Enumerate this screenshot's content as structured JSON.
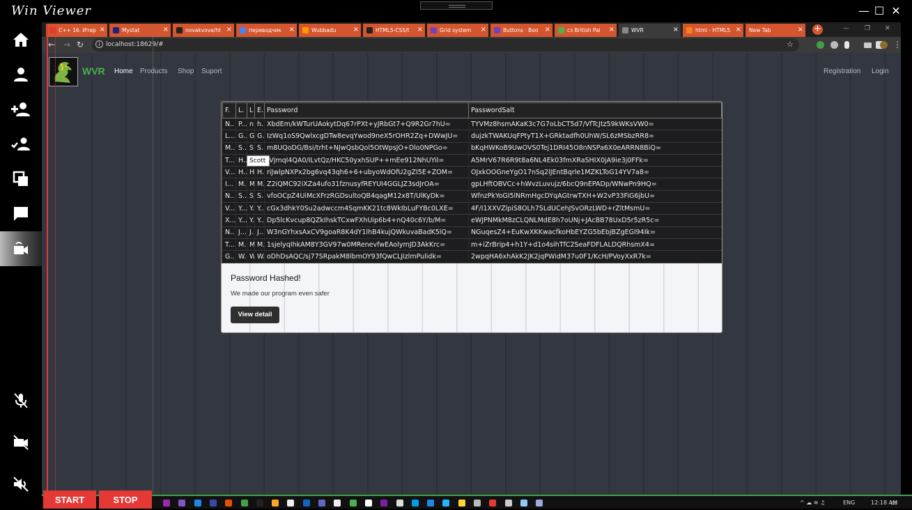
{
  "app": {
    "title": "Win Viewer",
    "window_controls": [
      "—",
      "☐",
      "✕"
    ]
  },
  "sidebar": {
    "items": [
      {
        "icon": "home-icon"
      },
      {
        "icon": "user-icon"
      },
      {
        "icon": "add-user-icon"
      },
      {
        "icon": "group-icon"
      },
      {
        "icon": "copy-icon"
      },
      {
        "icon": "chat-icon"
      },
      {
        "icon": "video-call-icon",
        "active": true
      },
      {
        "icon": "mic-off-icon"
      },
      {
        "icon": "camera-off-icon"
      },
      {
        "icon": "volume-off-icon"
      }
    ]
  },
  "browser": {
    "tabs": [
      {
        "label": "C++ 16. Итер",
        "color": "#e53935"
      },
      {
        "label": "Mystat",
        "color": "#1a237e"
      },
      {
        "label": "novakvova/ht",
        "color": "#222222"
      },
      {
        "label": "переводчик",
        "color": "#4285f4"
      },
      {
        "label": "Wubbadu",
        "color": "#ff9800"
      },
      {
        "label": "HTML5-CSS/t",
        "color": "#222222"
      },
      {
        "label": "Grid system",
        "color": "#6f42c1"
      },
      {
        "label": "Buttons · Boo",
        "color": "#6f42c1"
      },
      {
        "label": "сз British Pai",
        "color": "#4caf50"
      },
      {
        "label": "WVR",
        "color": "#888888",
        "active": true
      },
      {
        "label": "html - HTML5",
        "color": "#f48024"
      },
      {
        "label": "New Tab",
        "color": ""
      }
    ],
    "newtab_symbol": "+",
    "url": "localhost:18629/#",
    "nav_symbols": {
      "back": "←",
      "forward": "→",
      "reload": "↻",
      "info": "i",
      "star": "☆",
      "menu": "⋮"
    }
  },
  "site": {
    "brand": "WVR",
    "nav": [
      "Home",
      "Products",
      "Shop",
      "Suport"
    ],
    "nav_right": [
      "Registration",
      "Login"
    ]
  },
  "table": {
    "headers": [
      "F.",
      "L.",
      "L",
      "E.",
      "Password",
      "PasswordSalt"
    ],
    "rows": [
      [
        "N..",
        "P...",
        "n..",
        "h...",
        "XbdEm/kWTurUAokytDq67rPXt+yJRbGt7+Q9R2Gr7hU=",
        "TYVMz8hsmAKaK3c7G7oLbCT5d7/VfTcJtz59kWKsVW0="
      ],
      [
        "L...",
        "G..",
        "G.",
        "G..",
        "IzWq1oS9QwlxcgDTw8evqYwod9neX5rOHR2Zq+DWwJU=",
        "dujzkTWAKUqFPtyT1X+GRktadfh0UhW/SL6zMSbzRR8="
      ],
      [
        "M..",
        "S...",
        "S..",
        "S...",
        "m8UQoDG/Bsi/trht+NJwQsbQol5OtWpsJO+Dlo0NPGo=",
        "bKqHWKoB9UwOVS0Tej1DRI45O8nNSPa6X0eARRN8BiQ="
      ],
      [
        "T...",
        "H...",
        "",
        "",
        "/VjmqI4QA0/ILvtQz/HKC50yxhSUP++mEe912NhUYiI=",
        "A5MrV67R6R9t8a6NL4Ek03fmXRaSHIX0jA9ie3j0FFk="
      ],
      [
        "V...",
        "H..",
        "H",
        "H..",
        "riJwlpNXPx2bg6vq43qh6+6+ubyoWdOfU2gZI5E+ZOM=",
        "OJxkOOGneYgO17nSq2lJEntBqrle1MZKLToG14YV7a8="
      ],
      [
        "I...",
        "M..",
        "M",
        "M..",
        "Z2iQMC92iXZa4ufo31fznusyfREYUI4GGLJZ3sdJrOA=",
        "gpLHftOBVCc+hWvzLuvujz/6bcQ9nEPADp/WNwPn9HQ="
      ],
      [
        "N..",
        "S...",
        "S..",
        "S...",
        "vfoOCpZ4UiMcXFrzRGDsultoQB4qagM12x8T/UlKyDk=",
        "WfnzPkYoGI5lNRmHgcDYqAGtrwTXH+W2vP33FiG6jbU="
      ],
      [
        "V...",
        "Y...",
        "Y..",
        "Y...",
        "cGx3dhkY0Su2adwccm4SqmKK21tc8WkIbLuFYBc0LXE=",
        "4F/I1XXVZlpiS8OLh7SLdUCehJSvORzLWD+rZltMsmU="
      ],
      [
        "X...",
        "Y...",
        "Y..",
        "Y...",
        "Dp5lcKvcup8QZkIhskTCxwFXhUip6b4+nQ40c6Y/b/M=",
        "eWJPNMkM8zCLQNLMdE8h7oUNj+JAcBB78UxD5r5zR5c="
      ],
      [
        "N..",
        "J...",
        "J...",
        "J...",
        "W3nGYhxsAxCV9goaR8K4dY1lhB4kujQWkuvaBadK5lQ=",
        "NGuqesZ4+EuKwXKKwacfkoHbEYZG5bEbjBZgEGl94Ik="
      ],
      [
        "T...",
        "M..",
        "M",
        "M..",
        "1sjelyqIhkAM8Y3GV97w0MRenevfwEAolymJD3AkKrc=",
        "m+iZrBrip4+h1Y+d1o4sihTfC2SeaFDFLALDQRhsmX4="
      ],
      [
        "G..",
        "W..",
        "W.",
        "W..",
        "oDhDsAQC/sj77SRpakM8lbmOY93fQwCLJizlmPulidk=",
        "2wpqHA6xhAkK2JK2jqPWidM37u0F1/KcH/PVoyXxR7k="
      ]
    ],
    "tooltip": "Scott"
  },
  "card": {
    "title": "Password Hashed!",
    "text": "We made our program even safer",
    "button": "View detail"
  },
  "controls": {
    "start": "START",
    "stop": "STOP"
  },
  "taskbar": {
    "lang": "ENG",
    "time": "12:18 AM",
    "tray_symbols": "^ ☁ ≋ ♫"
  }
}
